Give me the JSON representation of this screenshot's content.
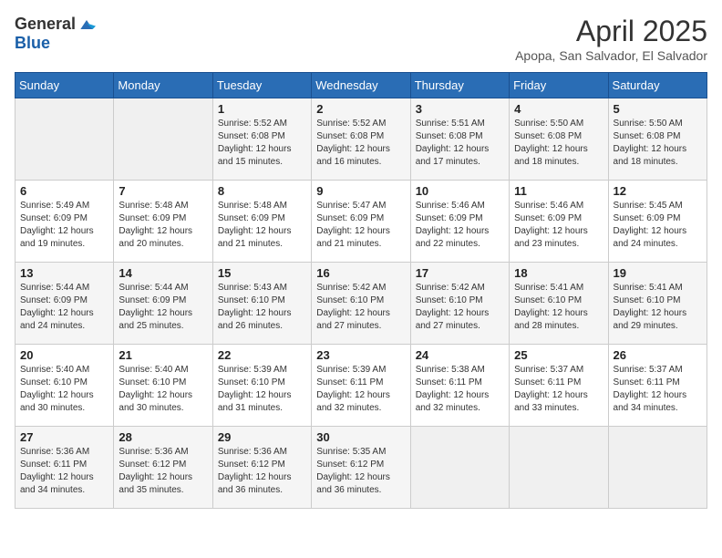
{
  "header": {
    "logo_general": "General",
    "logo_blue": "Blue",
    "month_title": "April 2025",
    "subtitle": "Apopa, San Salvador, El Salvador"
  },
  "days_of_week": [
    "Sunday",
    "Monday",
    "Tuesday",
    "Wednesday",
    "Thursday",
    "Friday",
    "Saturday"
  ],
  "weeks": [
    [
      {
        "day": "",
        "sunrise": "",
        "sunset": "",
        "daylight": ""
      },
      {
        "day": "",
        "sunrise": "",
        "sunset": "",
        "daylight": ""
      },
      {
        "day": "1",
        "sunrise": "Sunrise: 5:52 AM",
        "sunset": "Sunset: 6:08 PM",
        "daylight": "Daylight: 12 hours and 15 minutes."
      },
      {
        "day": "2",
        "sunrise": "Sunrise: 5:52 AM",
        "sunset": "Sunset: 6:08 PM",
        "daylight": "Daylight: 12 hours and 16 minutes."
      },
      {
        "day": "3",
        "sunrise": "Sunrise: 5:51 AM",
        "sunset": "Sunset: 6:08 PM",
        "daylight": "Daylight: 12 hours and 17 minutes."
      },
      {
        "day": "4",
        "sunrise": "Sunrise: 5:50 AM",
        "sunset": "Sunset: 6:08 PM",
        "daylight": "Daylight: 12 hours and 18 minutes."
      },
      {
        "day": "5",
        "sunrise": "Sunrise: 5:50 AM",
        "sunset": "Sunset: 6:08 PM",
        "daylight": "Daylight: 12 hours and 18 minutes."
      }
    ],
    [
      {
        "day": "6",
        "sunrise": "Sunrise: 5:49 AM",
        "sunset": "Sunset: 6:09 PM",
        "daylight": "Daylight: 12 hours and 19 minutes."
      },
      {
        "day": "7",
        "sunrise": "Sunrise: 5:48 AM",
        "sunset": "Sunset: 6:09 PM",
        "daylight": "Daylight: 12 hours and 20 minutes."
      },
      {
        "day": "8",
        "sunrise": "Sunrise: 5:48 AM",
        "sunset": "Sunset: 6:09 PM",
        "daylight": "Daylight: 12 hours and 21 minutes."
      },
      {
        "day": "9",
        "sunrise": "Sunrise: 5:47 AM",
        "sunset": "Sunset: 6:09 PM",
        "daylight": "Daylight: 12 hours and 21 minutes."
      },
      {
        "day": "10",
        "sunrise": "Sunrise: 5:46 AM",
        "sunset": "Sunset: 6:09 PM",
        "daylight": "Daylight: 12 hours and 22 minutes."
      },
      {
        "day": "11",
        "sunrise": "Sunrise: 5:46 AM",
        "sunset": "Sunset: 6:09 PM",
        "daylight": "Daylight: 12 hours and 23 minutes."
      },
      {
        "day": "12",
        "sunrise": "Sunrise: 5:45 AM",
        "sunset": "Sunset: 6:09 PM",
        "daylight": "Daylight: 12 hours and 24 minutes."
      }
    ],
    [
      {
        "day": "13",
        "sunrise": "Sunrise: 5:44 AM",
        "sunset": "Sunset: 6:09 PM",
        "daylight": "Daylight: 12 hours and 24 minutes."
      },
      {
        "day": "14",
        "sunrise": "Sunrise: 5:44 AM",
        "sunset": "Sunset: 6:09 PM",
        "daylight": "Daylight: 12 hours and 25 minutes."
      },
      {
        "day": "15",
        "sunrise": "Sunrise: 5:43 AM",
        "sunset": "Sunset: 6:10 PM",
        "daylight": "Daylight: 12 hours and 26 minutes."
      },
      {
        "day": "16",
        "sunrise": "Sunrise: 5:42 AM",
        "sunset": "Sunset: 6:10 PM",
        "daylight": "Daylight: 12 hours and 27 minutes."
      },
      {
        "day": "17",
        "sunrise": "Sunrise: 5:42 AM",
        "sunset": "Sunset: 6:10 PM",
        "daylight": "Daylight: 12 hours and 27 minutes."
      },
      {
        "day": "18",
        "sunrise": "Sunrise: 5:41 AM",
        "sunset": "Sunset: 6:10 PM",
        "daylight": "Daylight: 12 hours and 28 minutes."
      },
      {
        "day": "19",
        "sunrise": "Sunrise: 5:41 AM",
        "sunset": "Sunset: 6:10 PM",
        "daylight": "Daylight: 12 hours and 29 minutes."
      }
    ],
    [
      {
        "day": "20",
        "sunrise": "Sunrise: 5:40 AM",
        "sunset": "Sunset: 6:10 PM",
        "daylight": "Daylight: 12 hours and 30 minutes."
      },
      {
        "day": "21",
        "sunrise": "Sunrise: 5:40 AM",
        "sunset": "Sunset: 6:10 PM",
        "daylight": "Daylight: 12 hours and 30 minutes."
      },
      {
        "day": "22",
        "sunrise": "Sunrise: 5:39 AM",
        "sunset": "Sunset: 6:10 PM",
        "daylight": "Daylight: 12 hours and 31 minutes."
      },
      {
        "day": "23",
        "sunrise": "Sunrise: 5:39 AM",
        "sunset": "Sunset: 6:11 PM",
        "daylight": "Daylight: 12 hours and 32 minutes."
      },
      {
        "day": "24",
        "sunrise": "Sunrise: 5:38 AM",
        "sunset": "Sunset: 6:11 PM",
        "daylight": "Daylight: 12 hours and 32 minutes."
      },
      {
        "day": "25",
        "sunrise": "Sunrise: 5:37 AM",
        "sunset": "Sunset: 6:11 PM",
        "daylight": "Daylight: 12 hours and 33 minutes."
      },
      {
        "day": "26",
        "sunrise": "Sunrise: 5:37 AM",
        "sunset": "Sunset: 6:11 PM",
        "daylight": "Daylight: 12 hours and 34 minutes."
      }
    ],
    [
      {
        "day": "27",
        "sunrise": "Sunrise: 5:36 AM",
        "sunset": "Sunset: 6:11 PM",
        "daylight": "Daylight: 12 hours and 34 minutes."
      },
      {
        "day": "28",
        "sunrise": "Sunrise: 5:36 AM",
        "sunset": "Sunset: 6:12 PM",
        "daylight": "Daylight: 12 hours and 35 minutes."
      },
      {
        "day": "29",
        "sunrise": "Sunrise: 5:36 AM",
        "sunset": "Sunset: 6:12 PM",
        "daylight": "Daylight: 12 hours and 36 minutes."
      },
      {
        "day": "30",
        "sunrise": "Sunrise: 5:35 AM",
        "sunset": "Sunset: 6:12 PM",
        "daylight": "Daylight: 12 hours and 36 minutes."
      },
      {
        "day": "",
        "sunrise": "",
        "sunset": "",
        "daylight": ""
      },
      {
        "day": "",
        "sunrise": "",
        "sunset": "",
        "daylight": ""
      },
      {
        "day": "",
        "sunrise": "",
        "sunset": "",
        "daylight": ""
      }
    ]
  ]
}
